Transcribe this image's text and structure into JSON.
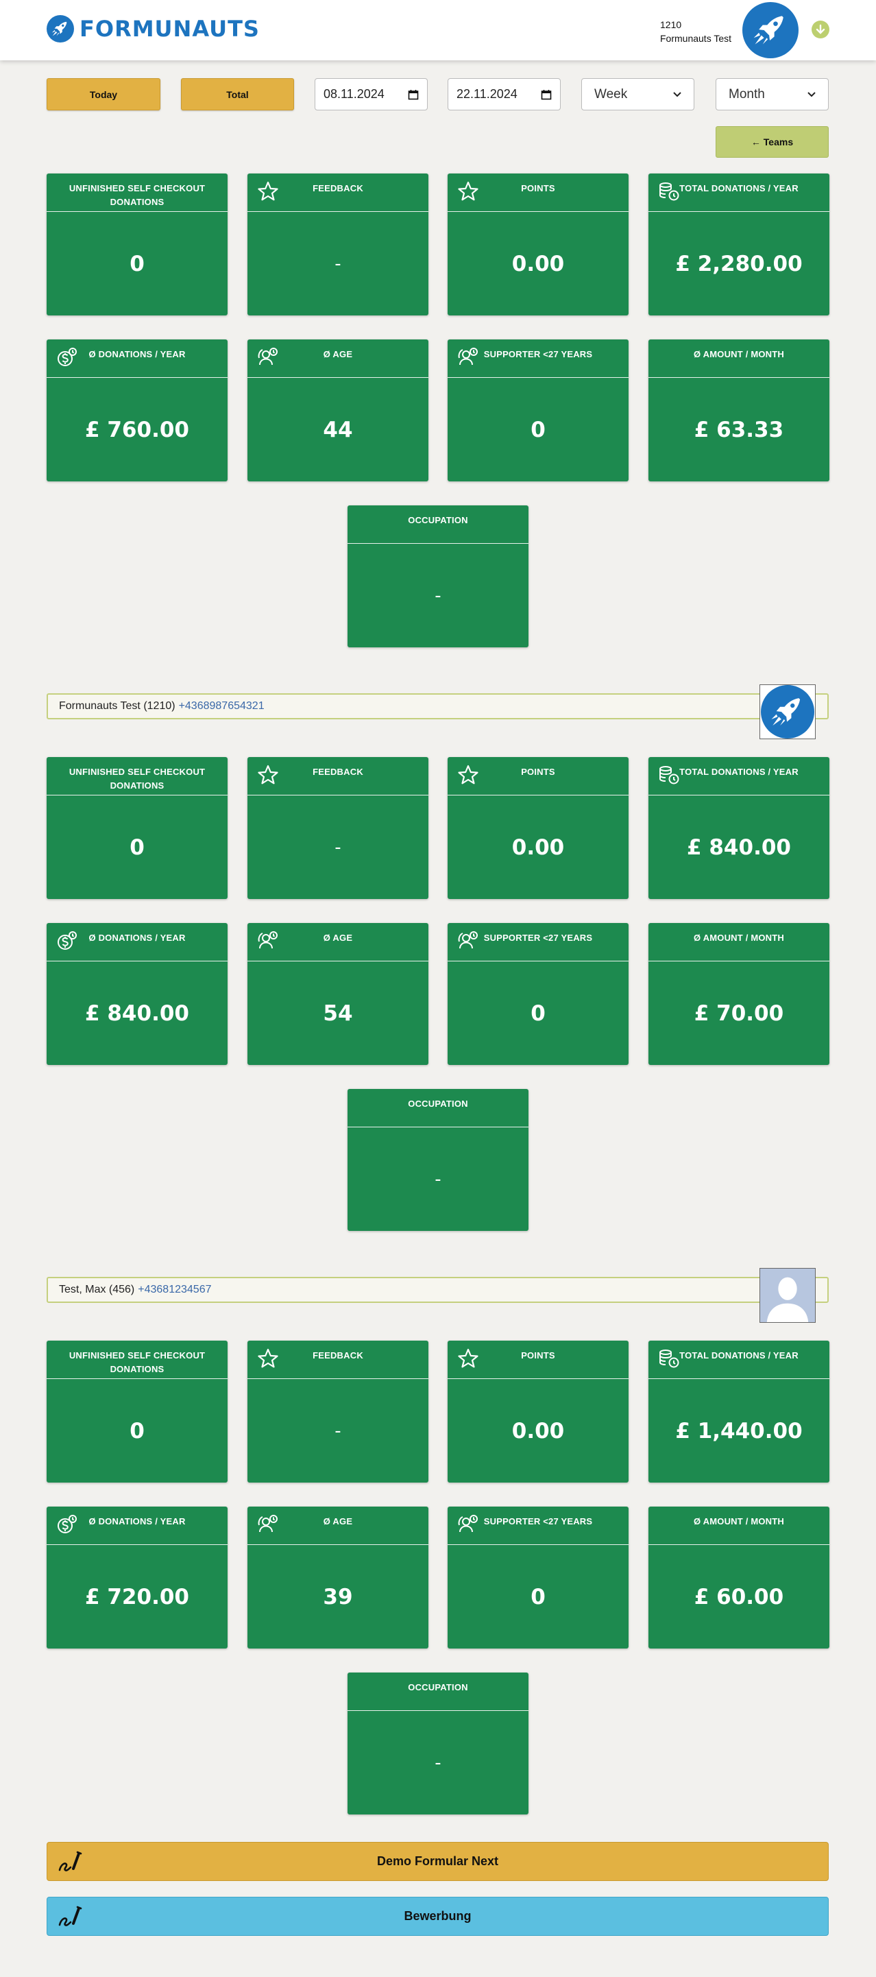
{
  "header": {
    "logo_text": "FORMUNAUTS",
    "user_id": "1210",
    "user_name": "Formunauts Test",
    "brand_color": "#1d74bf"
  },
  "filters": {
    "today_label": "Today",
    "total_label": "Total",
    "date_from": "08.11.2024",
    "date_to": "22.11.2024",
    "period_select": "Week",
    "range_select": "Month",
    "teams_label": "← Teams"
  },
  "labels": {
    "unfinished": "UNFINISHED SELF CHECKOUT DONATIONS",
    "feedback": "FEEDBACK",
    "points": "POINTS",
    "total_donations": "TOTAL DONATIONS / YEAR",
    "avg_donations": "Ø DONATIONS / YEAR",
    "avg_age": "Ø AGE",
    "supporter": "SUPPORTER <27 YEARS",
    "avg_amount": "Ø AMOUNT / MONTH",
    "occupation": "OCCUPATION"
  },
  "team_stats": {
    "unfinished": "0",
    "feedback": "-",
    "points": "0.00",
    "total_donations": "£ 2,280.00",
    "avg_donations": "£ 760.00",
    "avg_age": "44",
    "supporter": "0",
    "avg_amount": "£ 63.33",
    "occupation": "-"
  },
  "members": [
    {
      "name": "Formunauts Test (1210)",
      "phone": "+4368987654321",
      "stats": {
        "unfinished": "0",
        "feedback": "-",
        "points": "0.00",
        "total_donations": "£ 840.00",
        "avg_donations": "£ 840.00",
        "avg_age": "54",
        "supporter": "0",
        "avg_amount": "£ 70.00",
        "occupation": "-"
      }
    },
    {
      "name": "Test, Max (456)",
      "phone": "+43681234567",
      "stats": {
        "unfinished": "0",
        "feedback": "-",
        "points": "0.00",
        "total_donations": "£ 1,440.00",
        "avg_donations": "£ 720.00",
        "avg_age": "39",
        "supporter": "0",
        "avg_amount": "£ 60.00",
        "occupation": "-"
      }
    }
  ],
  "forms": [
    {
      "label": "Demo Formular Next",
      "color": "#e2b143"
    },
    {
      "label": "Bewerbung",
      "color": "#5bbfe0"
    }
  ],
  "colors": {
    "card_green": "#1d8a4f",
    "accent_olive": "#bfcd74",
    "button_yellow": "#e2b143"
  }
}
